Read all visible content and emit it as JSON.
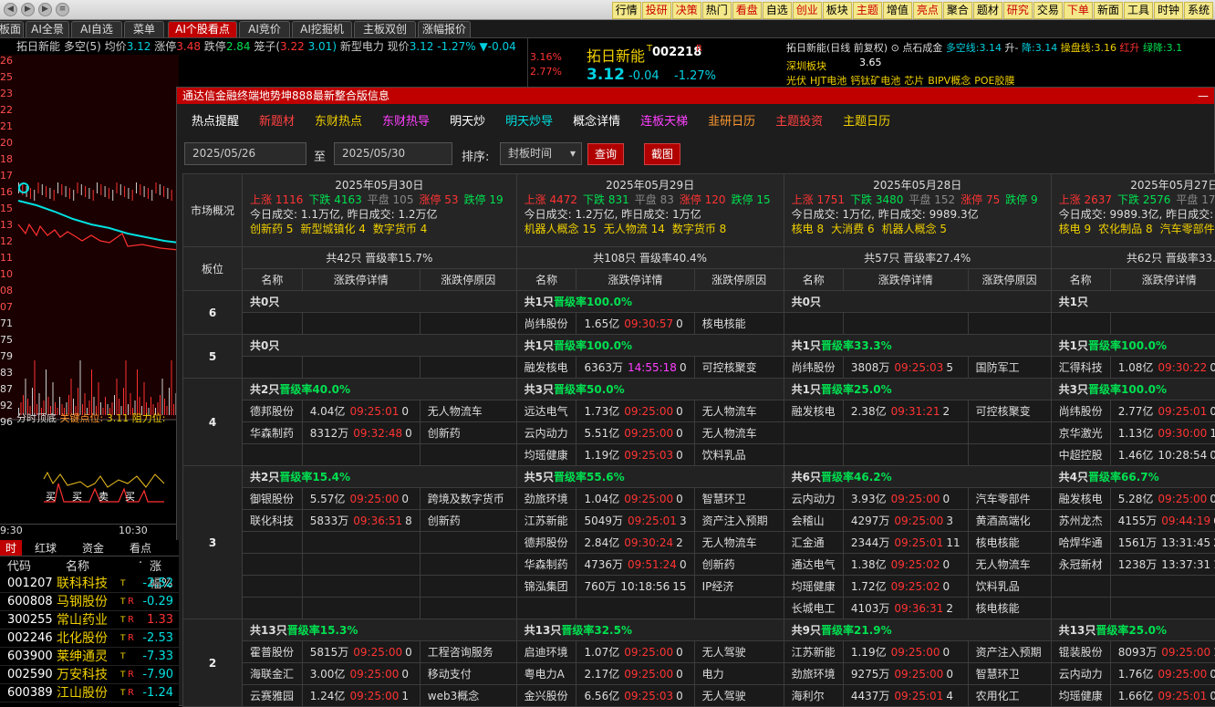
{
  "nav": {
    "back": "◀",
    "fwd": "▶",
    "menu": "≡"
  },
  "topmenu": [
    "行情",
    "投研",
    "决策",
    "热门",
    "看盘",
    "自选",
    "创业",
    "板块",
    "主题",
    "增值",
    "亮点",
    "聚合",
    "题材",
    "研究",
    "交易",
    "下单",
    "新面",
    "工具",
    "时钟",
    "系统"
  ],
  "tabs": [
    "板面",
    "AI全景",
    "AI自选",
    "菜单",
    "AI个股看点",
    "AI竞价",
    "AI挖掘机",
    "主板双创",
    "涨幅报价"
  ],
  "info": {
    "name": "拓日新能",
    "b1": "多空(5)",
    "b2": "均价",
    "avg": "3.12",
    "b3": "涨停",
    "up": "3.48",
    "b4": "跌停",
    "dn": "2.84",
    "b5": "笼子(",
    "c1": "3.22",
    "c2": "3.01)",
    "b6": "新型电力",
    "b7": "现价",
    "px": "3.12",
    "pct": "-1.27%",
    "chg": "▼-0.04"
  },
  "yaxis": [
    "26",
    "25",
    "23",
    "22",
    "21",
    "20",
    "18",
    "17",
    "16",
    "15",
    "13",
    "12",
    "11",
    "10",
    "08",
    "07",
    "71",
    "75",
    "79",
    "83",
    "87",
    "92",
    "96"
  ],
  "chartlabels": {
    "a": "分时顶底",
    "b": "关键点位:",
    "c": "3.11",
    "d": "阻力位:"
  },
  "signals": [
    "买",
    "买",
    "卖",
    "买"
  ],
  "time": {
    "t1": "9:30",
    "t2": "10:30"
  },
  "quote": {
    "p1": "3.16%",
    "p2": "2.77%",
    "name": "拓日新能",
    "code": "002218",
    "r": "R",
    "t": "T",
    "price": "3.12",
    "chg": "-0.04",
    "pct": "-1.27%"
  },
  "rightinfo": {
    "l1": "拓日新能(日线 前复权)",
    "l1b": "点石成金",
    "l1c": "多空线:",
    "v1": "3.14",
    "l1d": "升-",
    "l1e": "降:",
    "v2": "3.14",
    "l1f": "操盘线:",
    "v3": "3.16",
    "l1g": "红升",
    "l1h": "绿降:",
    "v4": "3.1",
    "board": "深圳板块",
    "price": "3.65",
    "tags": [
      "光伏",
      "HJT电池",
      "钙钛矿电池",
      "芯片",
      "BIPV概念",
      "POE胶膜"
    ]
  },
  "popup": {
    "title": "通达信金融终端地势坤888最新整合版信息",
    "close": "—",
    "subnav": [
      "热点提醒",
      "新题材",
      "东财热点",
      "东财热导",
      "明天炒",
      "明天炒导",
      "概念详情",
      "连板天梯",
      "韭研日历",
      "主题投资",
      "主题日历"
    ],
    "filter": {
      "from": "2025/05/26",
      "to_label": "至",
      "to": "2025/05/30",
      "sort_label": "排序:",
      "sort": "封板时间",
      "arrow": "▾",
      "query": "查询",
      "shot": "截图"
    },
    "overview_label": "市场概况",
    "days": [
      {
        "date": "2025年05月30日",
        "up": "上涨 1116",
        "down": "下跌 4163",
        "flat": "平盘 105",
        "zt": "涨停 53",
        "dt": "跌停 19",
        "vol": "今日成交: 1.1万亿, 昨日成交: 1.2万亿",
        "hot": [
          [
            "创新药",
            5
          ],
          [
            "新型城镇化",
            4
          ],
          [
            "数字货币",
            4
          ]
        ],
        "summary": "共42只 晋级率15.7%"
      },
      {
        "date": "2025年05月29日",
        "up": "上涨 4472",
        "down": "下跌 831",
        "flat": "平盘 83",
        "zt": "涨停 120",
        "dt": "跌停 15",
        "vol": "今日成交: 1.2万亿, 昨日成交: 1万亿",
        "hot": [
          [
            "机器人概念",
            15
          ],
          [
            "无人物流",
            14
          ],
          [
            "数字货币",
            8
          ]
        ],
        "summary": "共108只 晋级率40.4%"
      },
      {
        "date": "2025年05月28日",
        "up": "上涨 1751",
        "down": "下跌 3480",
        "flat": "平盘 152",
        "zt": "涨停 75",
        "dt": "跌停 9",
        "vol": "今日成交: 1万亿, 昨日成交: 9989.3亿",
        "hot": [
          [
            "核电",
            8
          ],
          [
            "大消费",
            6
          ],
          [
            "机器人概念",
            5
          ]
        ],
        "summary": "共57只 晋级率27.4%"
      },
      {
        "date": "2025年05月27日",
        "up": "上涨 2637",
        "down": "下跌 2576",
        "flat": "平盘 172",
        "zt": "",
        "dt": "",
        "vol": "今日成交: 9989.3亿, 昨日成交:",
        "hot": [
          [
            "核电",
            9
          ],
          [
            "农化制品",
            8
          ],
          [
            "汽车零部件",
            ""
          ]
        ],
        "summary": "共62只 晋级率33.9"
      }
    ],
    "board_label": "板位",
    "col_headers": [
      "名称",
      "涨跌停详情",
      "涨跌停原因"
    ],
    "levels": [
      {
        "lvl": "6",
        "groups": [
          {
            "cnt": "共0只",
            "rate": "",
            "rows": []
          },
          {
            "cnt": "共1只",
            "rate": "晋级率100.0%",
            "rows": [
              [
                "尚纬股份",
                "1.65亿",
                "09:30:57",
                "0",
                "核电核能"
              ]
            ]
          },
          {
            "cnt": "共0只",
            "rate": "",
            "rows": []
          },
          {
            "cnt": "共1只",
            "rate": "",
            "rows": []
          }
        ]
      },
      {
        "lvl": "5",
        "groups": [
          {
            "cnt": "共0只",
            "rate": "",
            "rows": []
          },
          {
            "cnt": "共1只",
            "rate": "晋级率100.0%",
            "rows": [
              [
                "融发核电",
                "6363万",
                "14:55:18",
                "0",
                "可控核聚变"
              ]
            ]
          },
          {
            "cnt": "共1只",
            "rate": "晋级率33.3%",
            "rows": [
              [
                "尚纬股份",
                "3808万",
                "09:25:03",
                "5",
                "国防军工"
              ]
            ]
          },
          {
            "cnt": "共1只",
            "rate": "晋级率100.0%",
            "rows": [
              [
                "汇得科技",
                "1.08亿",
                "09:30:22",
                "0",
                ""
              ]
            ]
          }
        ]
      },
      {
        "lvl": "4",
        "groups": [
          {
            "cnt": "共2只",
            "rate": "晋级率40.0%",
            "rows": [
              [
                "德邦股份",
                "4.04亿",
                "09:25:01",
                "0",
                "无人物流车"
              ],
              [
                "华森制药",
                "8312万",
                "09:32:48",
                "0",
                "创新药"
              ]
            ]
          },
          {
            "cnt": "共3只",
            "rate": "晋级率50.0%",
            "rows": [
              [
                "远达电气",
                "1.73亿",
                "09:25:00",
                "0",
                "无人物流车"
              ],
              [
                "云内动力",
                "5.51亿",
                "09:25:00",
                "0",
                "无人物流车"
              ],
              [
                "均瑶健康",
                "1.19亿",
                "09:25:03",
                "0",
                "饮料乳品"
              ]
            ]
          },
          {
            "cnt": "共1只",
            "rate": "晋级率25.0%",
            "rows": [
              [
                "融发核电",
                "2.38亿",
                "09:31:21",
                "2",
                "可控核聚变"
              ]
            ]
          },
          {
            "cnt": "共3只",
            "rate": "晋级率100.0%",
            "rows": [
              [
                "尚纬股份",
                "2.77亿",
                "09:25:01",
                "0",
                ""
              ],
              [
                "京华激光",
                "1.13亿",
                "09:30:00",
                "1",
                ""
              ],
              [
                "中超控股",
                "1.46亿",
                "10:28:54",
                "0",
                ""
              ]
            ]
          }
        ]
      },
      {
        "lvl": "3",
        "groups": [
          {
            "cnt": "共2只",
            "rate": "晋级率15.4%",
            "rows": [
              [
                "御银股份",
                "5.57亿",
                "09:25:00",
                "0",
                "跨境及数字货币"
              ],
              [
                "联化科技",
                "5833万",
                "09:36:51",
                "8",
                "创新药"
              ]
            ]
          },
          {
            "cnt": "共5只",
            "rate": "晋级率55.6%",
            "rows": [
              [
                "劲旅环境",
                "1.04亿",
                "09:25:00",
                "0",
                "智慧环卫"
              ],
              [
                "江苏新能",
                "5049万",
                "09:25:01",
                "3",
                "资产注入预期"
              ],
              [
                "德邦股份",
                "2.84亿",
                "09:30:24",
                "2",
                "无人物流车"
              ],
              [
                "华森制药",
                "4736万",
                "09:51:24",
                "0",
                "创新药"
              ],
              [
                "锦泓集团",
                "760万",
                "10:18:56",
                "15",
                "IP经济"
              ]
            ]
          },
          {
            "cnt": "共6只",
            "rate": "晋级率46.2%",
            "rows": [
              [
                "云内动力",
                "3.93亿",
                "09:25:00",
                "0",
                "汽车零部件"
              ],
              [
                "会稽山",
                "4297万",
                "09:25:00",
                "3",
                "黄酒高端化"
              ],
              [
                "汇金通",
                "2344万",
                "09:25:01",
                "11",
                "核电核能"
              ],
              [
                "通达电气",
                "1.38亿",
                "09:25:02",
                "0",
                "无人物流车"
              ],
              [
                "均瑶健康",
                "1.72亿",
                "09:25:02",
                "0",
                "饮料乳品"
              ],
              [
                "长城电工",
                "4103万",
                "09:36:31",
                "2",
                "核电核能"
              ]
            ]
          },
          {
            "cnt": "共4只",
            "rate": "晋级率66.7%",
            "rows": [
              [
                "融发核电",
                "5.28亿",
                "09:25:00",
                "0",
                ""
              ],
              [
                "苏州龙杰",
                "4155万",
                "09:44:19",
                "6",
                ""
              ],
              [
                "哈焊华通",
                "1561万",
                "13:31:45",
                "2",
                ""
              ],
              [
                "永冠新材",
                "1238万",
                "13:37:31",
                "1",
                ""
              ]
            ]
          }
        ]
      },
      {
        "lvl": "2",
        "groups": [
          {
            "cnt": "共13只",
            "rate": "晋级率15.3%",
            "rows": [
              [
                "霍普股份",
                "5815万",
                "09:25:00",
                "0",
                "工程咨询服务"
              ],
              [
                "海联金汇",
                "3.00亿",
                "09:25:00",
                "0",
                "移动支付"
              ],
              [
                "云赛雅园",
                "1.24亿",
                "09:25:00",
                "1",
                "web3概念"
              ]
            ]
          },
          {
            "cnt": "共13只",
            "rate": "晋级率32.5%",
            "rows": [
              [
                "启迪环境",
                "1.07亿",
                "09:25:00",
                "0",
                "无人驾驶"
              ],
              [
                "粤电力A",
                "2.17亿",
                "09:25:00",
                "0",
                "电力"
              ],
              [
                "金兴股份",
                "6.56亿",
                "09:25:03",
                "0",
                "无人驾驶"
              ]
            ]
          },
          {
            "cnt": "共9只",
            "rate": "晋级率21.9%",
            "rows": [
              [
                "江苏新能",
                "1.19亿",
                "09:25:00",
                "0",
                "资产注入预期"
              ],
              [
                "劲旅环境",
                "9275万",
                "09:25:00",
                "0",
                "智慧环卫"
              ],
              [
                "海利尔",
                "4437万",
                "09:25:01",
                "4",
                "农用化工"
              ]
            ]
          },
          {
            "cnt": "共13只",
            "rate": "晋级率25.0%",
            "rows": [
              [
                "锟装股份",
                "8093万",
                "09:25:00",
                "1",
                ""
              ],
              [
                "云内动力",
                "1.76亿",
                "09:25:00",
                "0",
                ""
              ],
              [
                "均瑶健康",
                "1.66亿",
                "09:25:01",
                "0",
                ""
              ]
            ]
          }
        ]
      }
    ]
  },
  "bottom": {
    "tabs": [
      "时",
      "红球",
      "资金",
      "看点"
    ],
    "headers": [
      "代码",
      "名称",
      "·",
      "涨幅%"
    ],
    "rows": [
      [
        "001207",
        "联科科技",
        "T",
        "",
        "-2.52"
      ],
      [
        "600808",
        "马钢股份",
        "T",
        "R",
        "-0.29"
      ],
      [
        "300255",
        "常山药业",
        "T",
        "R",
        "1.33"
      ],
      [
        "002246",
        "北化股份",
        "T",
        "R",
        "-2.53"
      ],
      [
        "603900",
        "莱绅通灵",
        "T",
        "",
        "-7.33"
      ],
      [
        "002590",
        "万安科技",
        "T",
        "R",
        "-7.90"
      ],
      [
        "600389",
        "江山股份",
        "T",
        "R",
        "-1.24"
      ]
    ]
  }
}
